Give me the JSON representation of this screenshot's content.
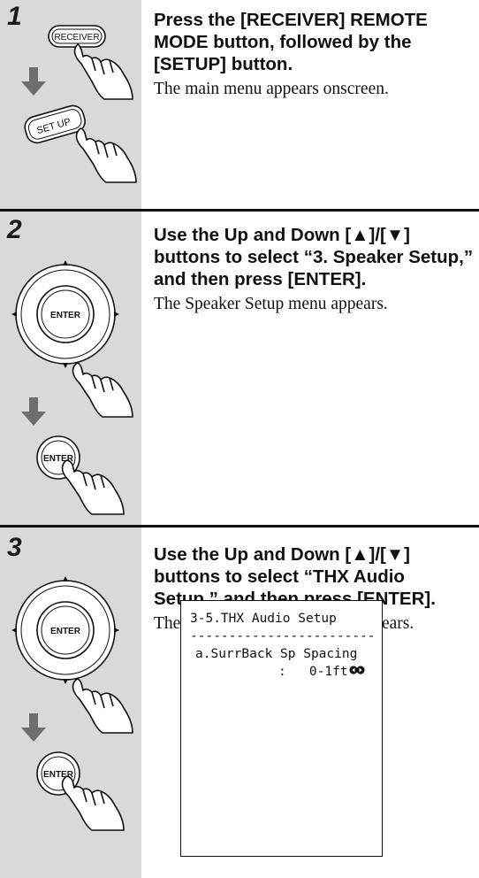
{
  "steps": [
    {
      "number": "1",
      "title": "Press the [RECEIVER] REMOTE MODE button, followed by the [SETUP] button.",
      "description": "The main menu appears onscreen.",
      "buttons": {
        "receiver": "RECEIVER",
        "setup": "SET UP"
      }
    },
    {
      "number": "2",
      "title": "Use the Up and Down [▲]/[▼] buttons to select “3. Speaker Setup,” and then press [ENTER].",
      "description": "The Speaker Setup menu appears.",
      "buttons": {
        "enter_ring": "ENTER",
        "enter": "ENTER"
      }
    },
    {
      "number": "3",
      "title": "Use the Up and Down [▲]/[▼] buttons to select “THX Audio Setup,” and then press [ENTER].",
      "description": "The THX Audio Setup menu appears.",
      "buttons": {
        "enter_ring": "ENTER",
        "enter": "ENTER"
      }
    }
  ],
  "osd": {
    "title": "3-5.THX Audio Setup",
    "rule": "------------------------",
    "item_label": "a.SurrBack Sp Spacing",
    "item_value": ":   0-1ft",
    "arrows_icon": "left-right-arrows-icon"
  }
}
